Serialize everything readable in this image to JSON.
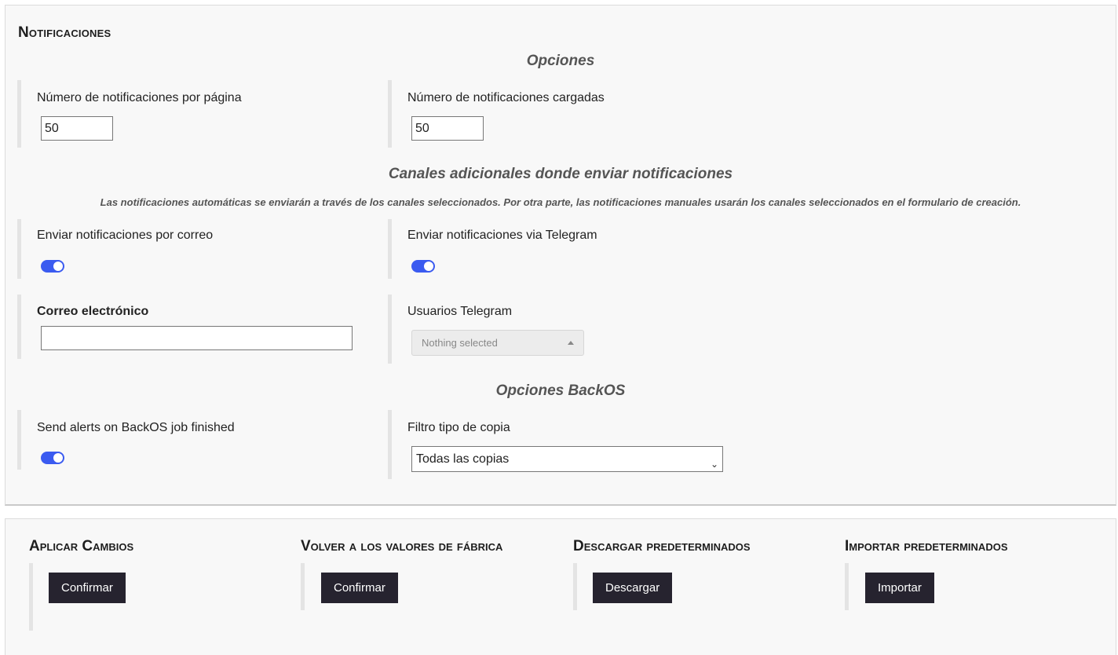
{
  "page_title": "Notificaciones",
  "sections": {
    "options_title": "Opciones",
    "channels_title": "Canales adicionales donde enviar notificaciones",
    "channels_note": "Las notificaciones automáticas se enviarán a través de los canales seleccionados. Por otra parte, las notificaciones manuales usarán los canales seleccionados en el formulario de creación.",
    "backos_title": "Opciones BackOS"
  },
  "fields": {
    "per_page_label": "Número de notificaciones por página",
    "per_page_value": "50",
    "loaded_label": "Número de notificaciones cargadas",
    "loaded_value": "50",
    "email_toggle_label": "Enviar notificaciones por correo",
    "email_toggle_on": true,
    "telegram_toggle_label": "Enviar notificaciones via Telegram",
    "telegram_toggle_on": true,
    "email_label": "Correo electrónico",
    "email_value": "",
    "telegram_users_label": "Usuarios Telegram",
    "telegram_users_placeholder": "Nothing selected",
    "backos_alert_label": "Send alerts on BackOS job finished",
    "backos_alert_on": true,
    "copy_filter_label": "Filtro tipo de copia",
    "copy_filter_value": "Todas las copias"
  },
  "actions": [
    {
      "title": "Aplicar Cambios",
      "button": "Confirmar"
    },
    {
      "title": "Volver a los valores de fábrica",
      "button": "Confirmar"
    },
    {
      "title": "Descargar predeterminados",
      "button": "Descargar"
    },
    {
      "title": "Importar predeterminados",
      "button": "Importar"
    }
  ],
  "colors": {
    "toggle_on": "#3b5bf0",
    "button_bg": "#26232f",
    "panel_bg": "#f8f8f8"
  }
}
